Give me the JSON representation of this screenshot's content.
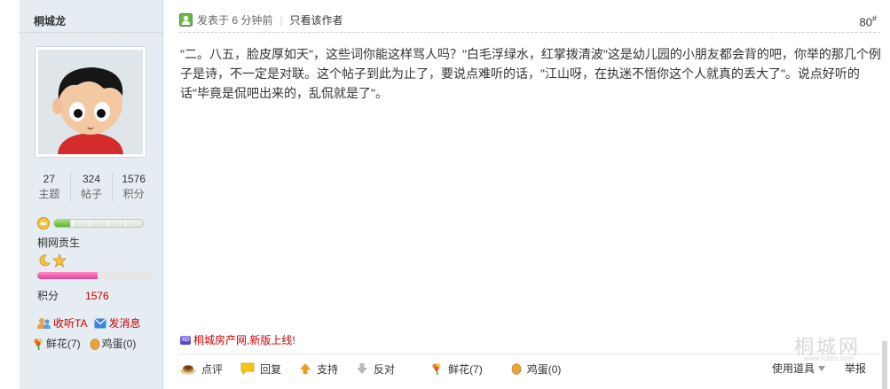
{
  "user": {
    "name": "桐城龙",
    "stats": [
      {
        "value": "27",
        "label": "主题"
      },
      {
        "value": "324",
        "label": "帖子"
      },
      {
        "value": "1576",
        "label": "积分"
      }
    ],
    "rank_name": "桐网贡生",
    "rank_progress": 0.18,
    "level_progress": 0.52,
    "score_label": "积分",
    "score_value": "1576",
    "follow_label": "收听TA",
    "message_label": "发消息",
    "flowers_label": "鲜花(7)",
    "eggs_label": "鸡蛋(0)"
  },
  "post": {
    "meta_posted": "发表于 6 分钟前",
    "meta_only_author": "只看该作者",
    "floor": "80",
    "floor_suffix": "#",
    "content": "\"二。八五，脸皮厚如天\"，这些词你能这样骂人吗？\"白毛浮绿水，红掌拨清波\"这是幼儿园的小朋友都会背的吧，你举的那几个例子是诗，不一定是对联。这个帖子到此为止了，要说点难听的话，\"江山呀，在执迷不悟你这个人就真的丢大了\"。说点好听的话\"毕竟是侃吧出来的，乱侃就是了\"。",
    "ad_badge": "AD",
    "ad_text": "桐城房产网,新版上线!"
  },
  "toolbar": {
    "rate": "点评",
    "reply": "回复",
    "support": "支持",
    "oppose": "反对",
    "flowers": "鲜花(7)",
    "eggs": "鸡蛋(0)",
    "tools": "使用道具",
    "report": "举报"
  },
  "watermark": {
    "text": "桐城网",
    "sub": "www.tcbbs.com"
  },
  "colors": {
    "sidebar_bg": "#e5edf2",
    "accent_red": "#cc0000",
    "rank_green": "#5fb336",
    "level_pink": "#e0459b"
  }
}
